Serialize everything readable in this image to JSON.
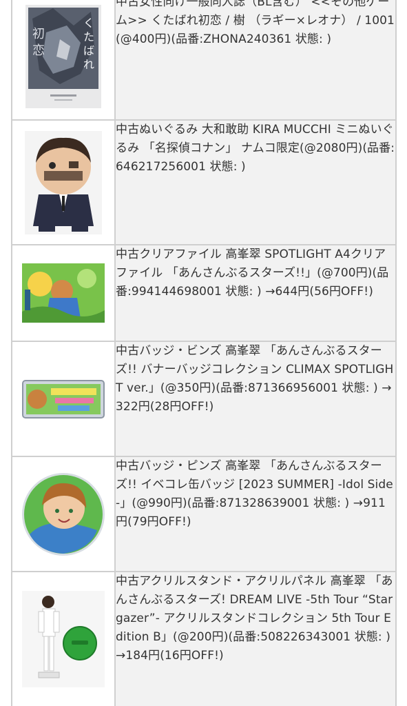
{
  "items": [
    {
      "image": "doujinshi-cover-image",
      "text": "中古女性向け一般同人誌（BL含む） <<その他ゲーム>> くたばれ初恋 / 樹 （ラギー×レオナ） / 1001(@400円)(品番:ZHONA240361 状態: )",
      "cover_text": "くたばれ 初恋"
    },
    {
      "image": "plush-doll-image",
      "text": "中古ぬいぐるみ 大和敢助 KIRA MUCCHI ミニぬいぐるみ 「名探偵コナン」 ナムコ限定(@2080円)(品番:646217256001 状態: )"
    },
    {
      "image": "clear-file-image",
      "text": "中古クリアファイル 高峯翠 SPOTLIGHT A4クリアファイル 「あんさんぶるスターズ!!」(@700円)(品番:994144698001 状態: ) →644円(56円OFF!)"
    },
    {
      "image": "banner-badge-image",
      "text": "中古バッジ・ビンズ 高峯翠 「あんさんぶるスターズ!! バナーバッジコレクション CLIMAX SPOTLIGHT ver.」(@350円)(品番:871366956001 状態: ) →322円(28円OFF!)"
    },
    {
      "image": "can-badge-image",
      "text": "中古バッジ・ピンズ 高峯翠 「あんさんぶるスターズ!! イベコレ缶バッジ [2023 SUMMER] -Idol Side-」(@990円)(品番:871328639001 状態: ) →911円(79円OFF!)"
    },
    {
      "image": "acrylic-stand-image",
      "text": "中古アクリルスタンド・アクリルパネル 高峯翠 「あんさんぶるスターズ! DREAM LIVE -5th Tour “Stargazer”- アクリルスタンドコレクション 5th Tour Edition B」(@200円)(品番:508226343001 状態: ) →184円(16円OFF!)"
    }
  ],
  "colors": {
    "border": "#cfcfcf",
    "text_cell_bg": "#f2f2f2",
    "text": "#333333"
  }
}
